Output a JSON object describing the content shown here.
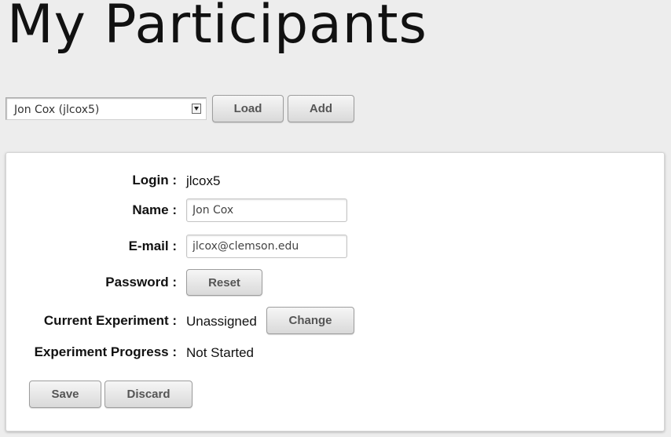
{
  "header": {
    "title": "My Participants"
  },
  "participant_picker": {
    "selected": "Jon Cox (jlcox5)",
    "load_label": "Load",
    "add_label": "Add"
  },
  "form": {
    "login": {
      "label": "Login :",
      "value": "jlcox5"
    },
    "name": {
      "label": "Name :",
      "value": "Jon Cox"
    },
    "email": {
      "label": "E-mail :",
      "value": "jlcox@clemson.edu"
    },
    "password": {
      "label": "Password :",
      "reset_label": "Reset"
    },
    "current_experiment": {
      "label": "Current Experiment :",
      "value": "Unassigned",
      "change_label": "Change"
    },
    "experiment_progress": {
      "label": "Experiment Progress :",
      "value": "Not Started"
    },
    "save_label": "Save",
    "discard_label": "Discard"
  },
  "colors": {
    "page_background": "#ededed",
    "panel_background": "#ffffff",
    "button_text": "#555555"
  }
}
